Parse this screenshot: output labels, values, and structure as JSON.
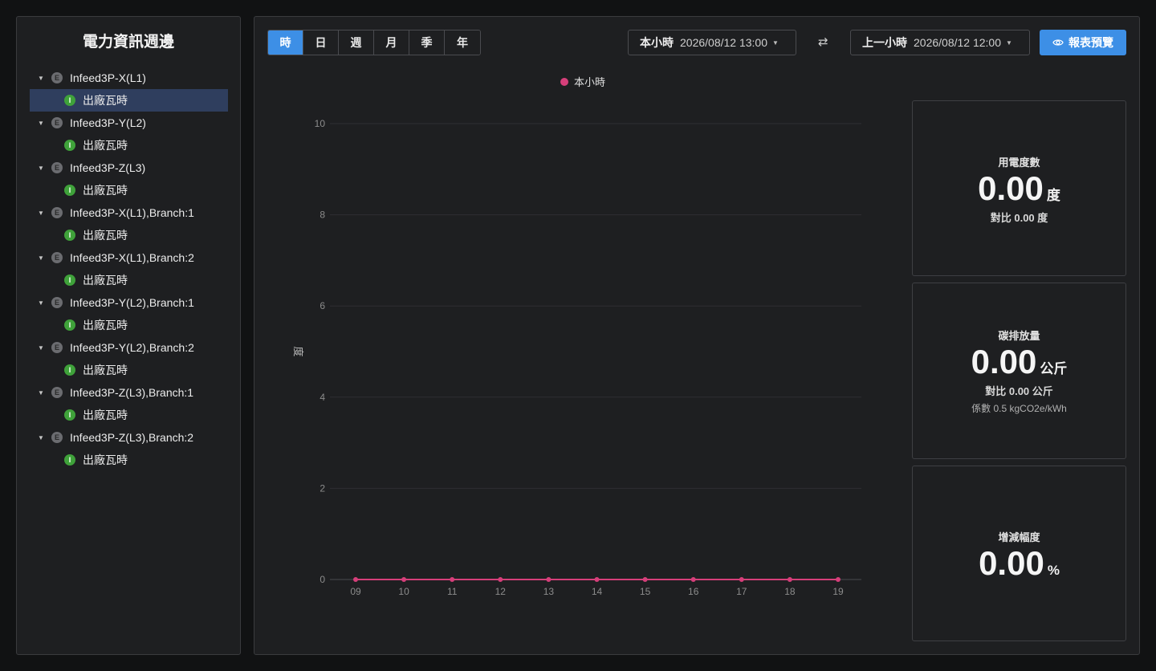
{
  "sidebar": {
    "title": "電力資訊週邊",
    "items": [
      {
        "badge": "E",
        "label": "Infeed3P-X(L1)",
        "child": {
          "badge": "I",
          "label": "出廠瓦時"
        }
      },
      {
        "badge": "E",
        "label": "Infeed3P-Y(L2)",
        "child": {
          "badge": "I",
          "label": "出廠瓦時"
        }
      },
      {
        "badge": "E",
        "label": "Infeed3P-Z(L3)",
        "child": {
          "badge": "I",
          "label": "出廠瓦時"
        }
      },
      {
        "badge": "E",
        "label": "Infeed3P-X(L1),Branch:1",
        "child": {
          "badge": "I",
          "label": "出廠瓦時"
        }
      },
      {
        "badge": "E",
        "label": "Infeed3P-X(L1),Branch:2",
        "child": {
          "badge": "I",
          "label": "出廠瓦時"
        }
      },
      {
        "badge": "E",
        "label": "Infeed3P-Y(L2),Branch:1",
        "child": {
          "badge": "I",
          "label": "出廠瓦時"
        }
      },
      {
        "badge": "E",
        "label": "Infeed3P-Y(L2),Branch:2",
        "child": {
          "badge": "I",
          "label": "出廠瓦時"
        }
      },
      {
        "badge": "E",
        "label": "Infeed3P-Z(L3),Branch:1",
        "child": {
          "badge": "I",
          "label": "出廠瓦時"
        }
      },
      {
        "badge": "E",
        "label": "Infeed3P-Z(L3),Branch:2",
        "child": {
          "badge": "I",
          "label": "出廠瓦時"
        }
      }
    ]
  },
  "toolbar": {
    "periods": [
      "時",
      "日",
      "週",
      "月",
      "季",
      "年"
    ],
    "active_period": "時",
    "current": {
      "label": "本小時",
      "value": "2026/08/12 13:00"
    },
    "swap_icon": "⇄",
    "previous": {
      "label": "上一小時",
      "value": "2026/08/12 12:00"
    },
    "preview_label": "報表預覽"
  },
  "chart_data": {
    "type": "line",
    "legend": "本小時",
    "ylabel": "度",
    "x": [
      "09",
      "10",
      "11",
      "12",
      "13",
      "14",
      "15",
      "16",
      "17",
      "18",
      "19"
    ],
    "series": [
      {
        "name": "本小時",
        "values": [
          0,
          0,
          0,
          0,
          0,
          0,
          0,
          0,
          0,
          0,
          0
        ]
      }
    ],
    "yticks": [
      0,
      2,
      4,
      6,
      8,
      10
    ],
    "ylim": [
      0,
      10
    ],
    "grid": true,
    "color": "#d63f7a"
  },
  "stats": {
    "usage": {
      "label": "用電度數",
      "value": "0.00",
      "unit": "度",
      "compare": "對比 0.00 度"
    },
    "carbon": {
      "label": "碳排放量",
      "value": "0.00",
      "unit": "公斤",
      "compare": "對比 0.00 公斤",
      "note": "係數 0.5 kgCO2e/kWh"
    },
    "change": {
      "label": "增減幅度",
      "value": "0.00",
      "unit": "%"
    }
  },
  "colors": {
    "accent": "#3d8fe6",
    "series": "#d63f7a",
    "badge_e": "#6b6c70",
    "badge_i": "#3fa23a"
  }
}
